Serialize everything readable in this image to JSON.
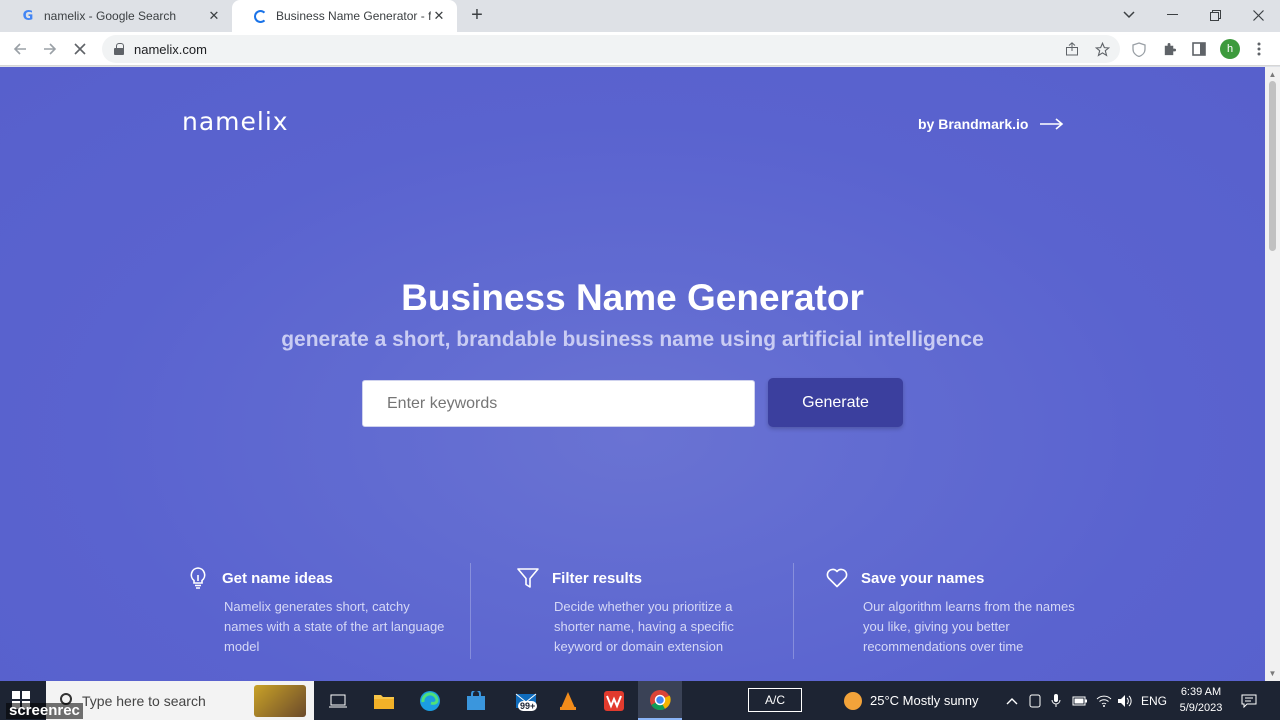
{
  "browser": {
    "tabs": [
      {
        "title": "namelix - Google Search",
        "favicon": "google-g-icon"
      },
      {
        "title": "Business Name Generator - free",
        "favicon": "loading-spinner-icon"
      }
    ],
    "new_tab": "+",
    "url": "namelix.com",
    "profile_initial": "h"
  },
  "page": {
    "logo": "namelix",
    "by_link": "by Brandmark.io",
    "hero_title": "Business Name Generator",
    "hero_subtitle": "generate a short, brandable business name using artificial intelligence",
    "search": {
      "placeholder": "Enter keywords",
      "value": ""
    },
    "generate_label": "Generate",
    "features": [
      {
        "icon": "lightbulb-icon",
        "title": "Get name ideas",
        "desc": "Namelix generates short, catchy names with a state of the art language model"
      },
      {
        "icon": "filter-icon",
        "title": "Filter results",
        "desc": "Decide whether you prioritize a shorter name, having a specific keyword or domain extension"
      },
      {
        "icon": "heart-icon",
        "title": "Save your names",
        "desc": "Our algorithm learns from the names you like, giving you better recommendations over time"
      }
    ]
  },
  "taskbar": {
    "search_placeholder": "Type here to search",
    "mail_badge": "99+",
    "ac_label": "A/C",
    "weather": "25°C  Mostly sunny",
    "language": "ENG",
    "time": "6:39 AM",
    "date": "5/9/2023",
    "watermark": "screenrec"
  }
}
